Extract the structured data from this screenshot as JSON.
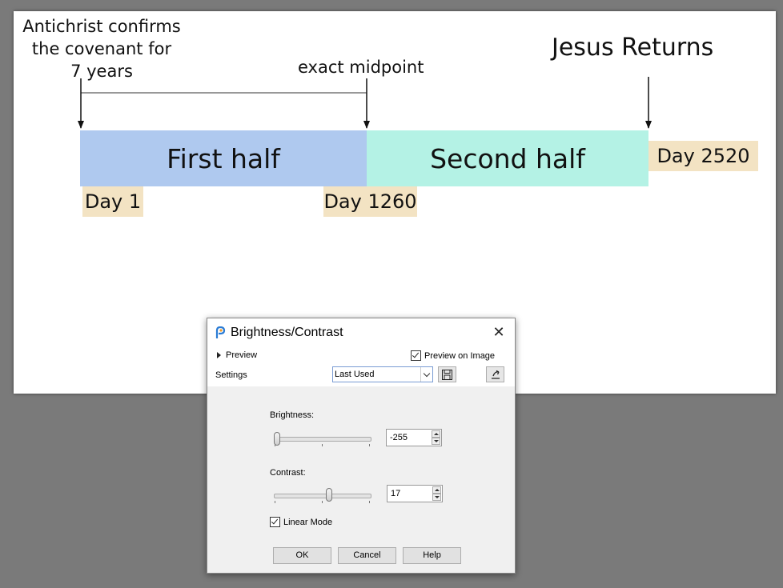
{
  "canvas": {
    "antichrist_label": "Antichrist confirms\nthe covenant for\n7 years",
    "midpoint_label": "exact midpoint",
    "jesus_label": "Jesus Returns",
    "first_half": "First half",
    "second_half": "Second half",
    "day_start": "Day 1",
    "day_mid": "Day 1260",
    "day_end": "Day 2520",
    "colors": {
      "first_half": "#afc9ef",
      "second_half": "#b4f2e5",
      "day_tag": "#f3e3c3"
    }
  },
  "dialog": {
    "title": "Brightness/Contrast",
    "preview_toggle": "Preview",
    "preview_on_image": "Preview on Image",
    "preview_on_image_checked": true,
    "settings_label": "Settings",
    "settings_value": "Last Used",
    "brightness": {
      "label": "Brightness:",
      "value": "-255",
      "range": [
        -255,
        255
      ]
    },
    "contrast": {
      "label": "Contrast:",
      "value": "17",
      "range": [
        -100,
        100
      ]
    },
    "linear_mode": "Linear Mode",
    "linear_mode_checked": true,
    "buttons": {
      "ok": "OK",
      "cancel": "Cancel",
      "help": "Help"
    },
    "icons": {
      "app": "paintshop-icon",
      "close": "close-icon",
      "save": "save-icon",
      "reset": "reset-icon"
    }
  }
}
